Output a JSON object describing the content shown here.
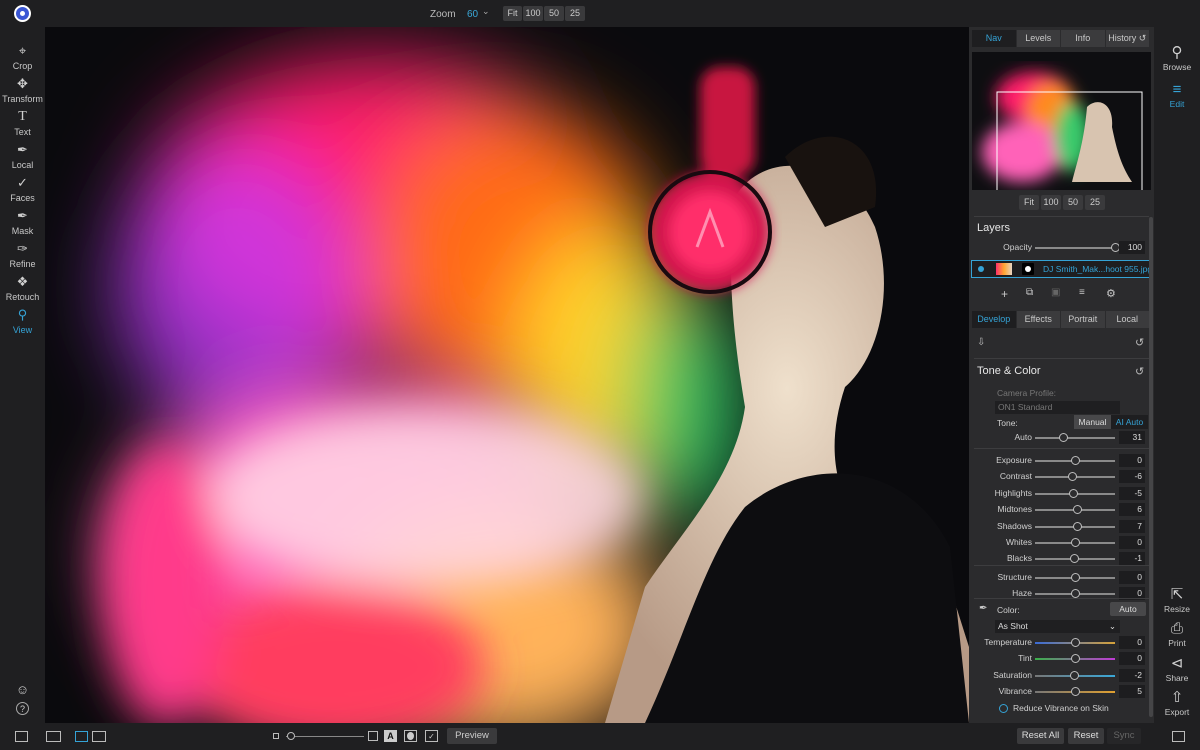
{
  "top": {
    "zoom_label": "Zoom",
    "zoom_value": "60",
    "zoom_buttons": [
      "Fit",
      "100",
      "50",
      "25"
    ]
  },
  "left_tools": [
    {
      "label": "Crop",
      "icon": "crop-icon"
    },
    {
      "label": "Transform",
      "icon": "move-icon"
    },
    {
      "label": "Text",
      "icon": "text-icon"
    },
    {
      "label": "Local",
      "icon": "local-brush-icon"
    },
    {
      "label": "Faces",
      "icon": "faces-icon"
    },
    {
      "label": "Mask",
      "icon": "mask-brush-icon"
    },
    {
      "label": "Refine",
      "icon": "refine-brush-icon"
    },
    {
      "label": "Retouch",
      "icon": "retouch-icon"
    },
    {
      "label": "View",
      "icon": "view-zoom-icon",
      "active": true
    }
  ],
  "panel": {
    "top_tabs": [
      "Nav",
      "Levels",
      "Info",
      "History"
    ],
    "nav_zoom_buttons": [
      "Fit",
      "100",
      "50",
      "25"
    ],
    "layers": {
      "title": "Layers",
      "opacity_label": "Opacity",
      "opacity_value": "100",
      "opacity_fraction": 1.0,
      "layer_name": "DJ Smith_Mak...hoot 955.jpg"
    },
    "edit_tabs": [
      "Develop",
      "Effects",
      "Portrait",
      "Local"
    ],
    "tone_color": {
      "title": "Tone & Color",
      "camera_profile_label": "Camera Profile:",
      "camera_profile_value": "ON1 Standard",
      "tone_label": "Tone:",
      "tone_manual": "Manual",
      "tone_ai_auto": "AI Auto",
      "auto": {
        "label": "Auto",
        "value": "31",
        "fraction": 0.36
      },
      "tone_sliders": [
        {
          "label": "Exposure",
          "value": "0",
          "fraction": 0.5
        },
        {
          "label": "Contrast",
          "value": "-6",
          "fraction": 0.47
        },
        {
          "label": "Highlights",
          "value": "-5",
          "fraction": 0.475
        },
        {
          "label": "Midtones",
          "value": "6",
          "fraction": 0.53
        },
        {
          "label": "Shadows",
          "value": "7",
          "fraction": 0.535
        },
        {
          "label": "Whites",
          "value": "0",
          "fraction": 0.5
        },
        {
          "label": "Blacks",
          "value": "-1",
          "fraction": 0.495
        }
      ],
      "detail_sliders": [
        {
          "label": "Structure",
          "value": "0",
          "fraction": 0.5
        },
        {
          "label": "Haze",
          "value": "0",
          "fraction": 0.5
        }
      ],
      "color_label": "Color:",
      "color_auto": "Auto",
      "white_balance": "As Shot",
      "color_sliders": [
        {
          "label": "Temperature",
          "value": "0",
          "fraction": 0.5
        },
        {
          "label": "Tint",
          "value": "0",
          "fraction": 0.5
        },
        {
          "label": "Saturation",
          "value": "-2",
          "fraction": 0.49
        },
        {
          "label": "Vibrance",
          "value": "5",
          "fraction": 0.51
        }
      ],
      "reduce_vibrance": "Reduce Vibrance on Skin"
    }
  },
  "right_modules": [
    {
      "label": "Browse",
      "icon": "browse-icon"
    },
    {
      "label": "Edit",
      "icon": "edit-sliders-icon",
      "active": true
    },
    {
      "label": "Resize",
      "icon": "resize-icon"
    },
    {
      "label": "Print",
      "icon": "print-icon"
    },
    {
      "label": "Share",
      "icon": "share-icon"
    },
    {
      "label": "Export",
      "icon": "export-icon"
    }
  ],
  "bottom": {
    "preview": "Preview",
    "reset_all": "Reset All",
    "reset": "Reset",
    "sync": "Sync"
  },
  "colors": {
    "accent": "#35a3d6",
    "panel": "#2b2b2d",
    "chrome": "#1f1f21"
  }
}
